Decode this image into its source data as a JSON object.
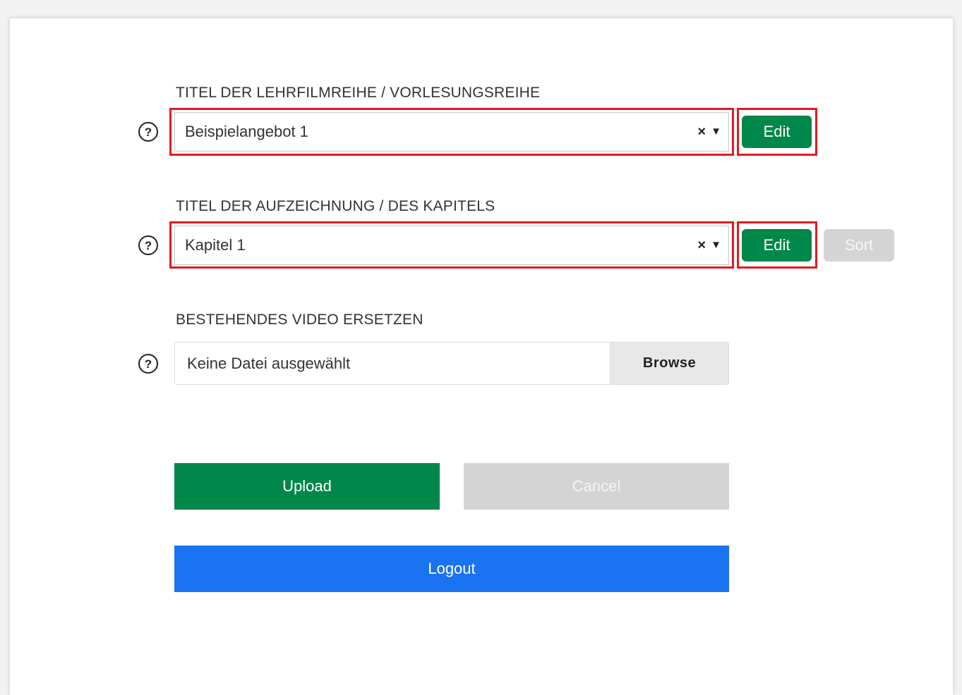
{
  "series_title": {
    "label": "TITEL DER LEHRFILMREIHE / VORLESUNGSREIHE",
    "value": "Beispielangebot 1",
    "clear": "×",
    "arrow": "▼",
    "edit_label": "Edit"
  },
  "chapter_title": {
    "label": "TITEL DER AUFZEICHNUNG / DES KAPITELS",
    "value": "Kapitel 1",
    "clear": "×",
    "arrow": "▼",
    "edit_label": "Edit",
    "sort_label": "Sort"
  },
  "replace_video": {
    "label": "BESTEHENDES VIDEO ERSETZEN",
    "placeholder": "Keine Datei ausgewählt",
    "browse_label": "Browse"
  },
  "help_icon": "?",
  "actions": {
    "upload_label": "Upload",
    "cancel_label": "Cancel",
    "logout_label": "Logout"
  },
  "colors": {
    "primary_green": "#00874a",
    "logout_blue": "#1a73f0",
    "disabled_gray": "#d4d4d4",
    "highlight_red": "#e11b22"
  }
}
